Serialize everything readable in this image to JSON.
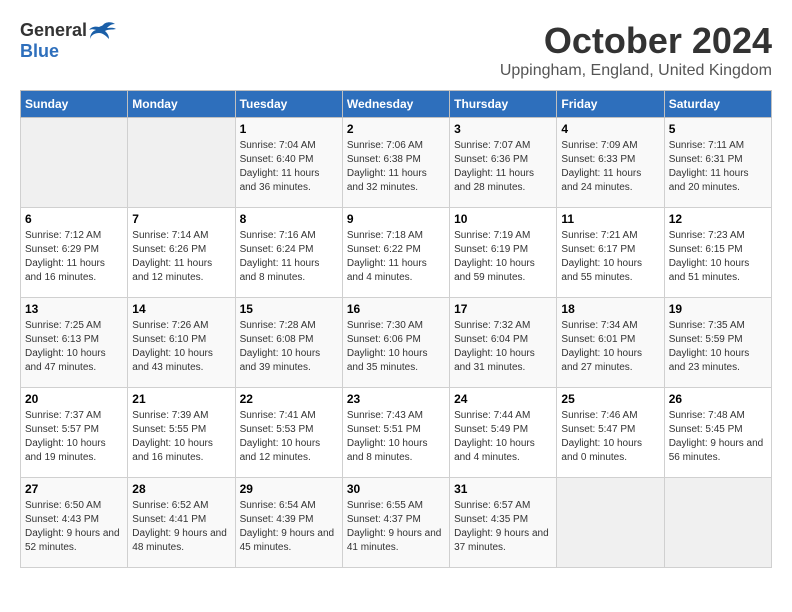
{
  "header": {
    "logo_general": "General",
    "logo_blue": "Blue",
    "month_title": "October 2024",
    "location": "Uppingham, England, United Kingdom"
  },
  "weekdays": [
    "Sunday",
    "Monday",
    "Tuesday",
    "Wednesday",
    "Thursday",
    "Friday",
    "Saturday"
  ],
  "weeks": [
    [
      {
        "day": "",
        "info": ""
      },
      {
        "day": "",
        "info": ""
      },
      {
        "day": "1",
        "info": "Sunrise: 7:04 AM\nSunset: 6:40 PM\nDaylight: 11 hours and 36 minutes."
      },
      {
        "day": "2",
        "info": "Sunrise: 7:06 AM\nSunset: 6:38 PM\nDaylight: 11 hours and 32 minutes."
      },
      {
        "day": "3",
        "info": "Sunrise: 7:07 AM\nSunset: 6:36 PM\nDaylight: 11 hours and 28 minutes."
      },
      {
        "day": "4",
        "info": "Sunrise: 7:09 AM\nSunset: 6:33 PM\nDaylight: 11 hours and 24 minutes."
      },
      {
        "day": "5",
        "info": "Sunrise: 7:11 AM\nSunset: 6:31 PM\nDaylight: 11 hours and 20 minutes."
      }
    ],
    [
      {
        "day": "6",
        "info": "Sunrise: 7:12 AM\nSunset: 6:29 PM\nDaylight: 11 hours and 16 minutes."
      },
      {
        "day": "7",
        "info": "Sunrise: 7:14 AM\nSunset: 6:26 PM\nDaylight: 11 hours and 12 minutes."
      },
      {
        "day": "8",
        "info": "Sunrise: 7:16 AM\nSunset: 6:24 PM\nDaylight: 11 hours and 8 minutes."
      },
      {
        "day": "9",
        "info": "Sunrise: 7:18 AM\nSunset: 6:22 PM\nDaylight: 11 hours and 4 minutes."
      },
      {
        "day": "10",
        "info": "Sunrise: 7:19 AM\nSunset: 6:19 PM\nDaylight: 10 hours and 59 minutes."
      },
      {
        "day": "11",
        "info": "Sunrise: 7:21 AM\nSunset: 6:17 PM\nDaylight: 10 hours and 55 minutes."
      },
      {
        "day": "12",
        "info": "Sunrise: 7:23 AM\nSunset: 6:15 PM\nDaylight: 10 hours and 51 minutes."
      }
    ],
    [
      {
        "day": "13",
        "info": "Sunrise: 7:25 AM\nSunset: 6:13 PM\nDaylight: 10 hours and 47 minutes."
      },
      {
        "day": "14",
        "info": "Sunrise: 7:26 AM\nSunset: 6:10 PM\nDaylight: 10 hours and 43 minutes."
      },
      {
        "day": "15",
        "info": "Sunrise: 7:28 AM\nSunset: 6:08 PM\nDaylight: 10 hours and 39 minutes."
      },
      {
        "day": "16",
        "info": "Sunrise: 7:30 AM\nSunset: 6:06 PM\nDaylight: 10 hours and 35 minutes."
      },
      {
        "day": "17",
        "info": "Sunrise: 7:32 AM\nSunset: 6:04 PM\nDaylight: 10 hours and 31 minutes."
      },
      {
        "day": "18",
        "info": "Sunrise: 7:34 AM\nSunset: 6:01 PM\nDaylight: 10 hours and 27 minutes."
      },
      {
        "day": "19",
        "info": "Sunrise: 7:35 AM\nSunset: 5:59 PM\nDaylight: 10 hours and 23 minutes."
      }
    ],
    [
      {
        "day": "20",
        "info": "Sunrise: 7:37 AM\nSunset: 5:57 PM\nDaylight: 10 hours and 19 minutes."
      },
      {
        "day": "21",
        "info": "Sunrise: 7:39 AM\nSunset: 5:55 PM\nDaylight: 10 hours and 16 minutes."
      },
      {
        "day": "22",
        "info": "Sunrise: 7:41 AM\nSunset: 5:53 PM\nDaylight: 10 hours and 12 minutes."
      },
      {
        "day": "23",
        "info": "Sunrise: 7:43 AM\nSunset: 5:51 PM\nDaylight: 10 hours and 8 minutes."
      },
      {
        "day": "24",
        "info": "Sunrise: 7:44 AM\nSunset: 5:49 PM\nDaylight: 10 hours and 4 minutes."
      },
      {
        "day": "25",
        "info": "Sunrise: 7:46 AM\nSunset: 5:47 PM\nDaylight: 10 hours and 0 minutes."
      },
      {
        "day": "26",
        "info": "Sunrise: 7:48 AM\nSunset: 5:45 PM\nDaylight: 9 hours and 56 minutes."
      }
    ],
    [
      {
        "day": "27",
        "info": "Sunrise: 6:50 AM\nSunset: 4:43 PM\nDaylight: 9 hours and 52 minutes."
      },
      {
        "day": "28",
        "info": "Sunrise: 6:52 AM\nSunset: 4:41 PM\nDaylight: 9 hours and 48 minutes."
      },
      {
        "day": "29",
        "info": "Sunrise: 6:54 AM\nSunset: 4:39 PM\nDaylight: 9 hours and 45 minutes."
      },
      {
        "day": "30",
        "info": "Sunrise: 6:55 AM\nSunset: 4:37 PM\nDaylight: 9 hours and 41 minutes."
      },
      {
        "day": "31",
        "info": "Sunrise: 6:57 AM\nSunset: 4:35 PM\nDaylight: 9 hours and 37 minutes."
      },
      {
        "day": "",
        "info": ""
      },
      {
        "day": "",
        "info": ""
      }
    ]
  ]
}
